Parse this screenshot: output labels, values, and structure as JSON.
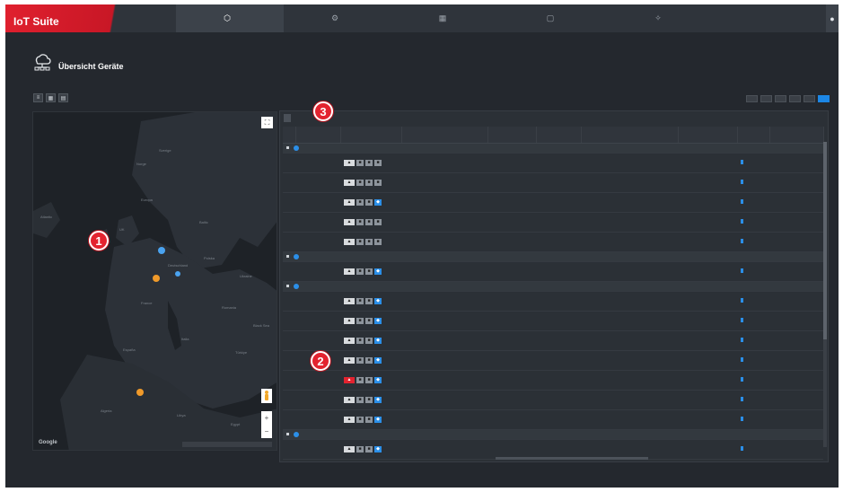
{
  "app": {
    "brand_small": "",
    "brand_name": "IoT Suite"
  },
  "nav": {
    "tabs": [
      {
        "label": "",
        "icon": "cube-icon"
      },
      {
        "label": "",
        "icon": "wrench-icon"
      },
      {
        "label": "",
        "icon": "grid-icon"
      },
      {
        "label": "",
        "icon": "box-icon"
      },
      {
        "label": "",
        "icon": "puzzle-icon"
      }
    ]
  },
  "page": {
    "breadcrumb": "",
    "title": "Übersicht Geräte"
  },
  "map": {
    "labels": [
      "Europa",
      "Atlantic",
      "Deutschland",
      "France",
      "España",
      "Italia",
      "Polska",
      "Sverige",
      "Norge",
      "UK",
      "Türkiye",
      "Ukraine",
      "Romania",
      "Algeria",
      "Libya",
      "Egypt",
      "Baltic",
      "Black Sea"
    ],
    "attribution": "Google"
  },
  "table": {
    "group_chip": "",
    "columns": [
      "",
      "",
      "",
      "",
      "",
      "",
      "",
      "",
      "",
      "",
      ""
    ],
    "groups": [
      {
        "label": "",
        "count_badge": "",
        "rows": [
          {
            "status": [
              "warn",
              "w",
              "w",
              "w"
            ],
            "name": "",
            "city": "",
            "country": "",
            "addr": "",
            "serial": "",
            "date": ""
          },
          {
            "status": [
              "warn",
              "w",
              "w",
              "w"
            ],
            "name": "",
            "city": "",
            "country": "",
            "addr": "",
            "serial": "",
            "date": ""
          },
          {
            "status": [
              "warn",
              "w",
              "w",
              "blue"
            ],
            "name": "",
            "city": "",
            "country": "",
            "addr": "",
            "serial": "",
            "date": ""
          },
          {
            "status": [
              "warn",
              "w",
              "w",
              "w"
            ],
            "name": "",
            "city": "",
            "country": "",
            "addr": "",
            "serial": "",
            "date": ""
          },
          {
            "status": [
              "warn",
              "w",
              "w",
              "w"
            ],
            "name": "",
            "city": "",
            "country": "",
            "addr": "",
            "serial": "",
            "date": ""
          }
        ]
      },
      {
        "label": "",
        "count_badge": "",
        "rows": [
          {
            "status": [
              "warn",
              "w",
              "w",
              "blue"
            ],
            "name": "",
            "city": "",
            "country": "",
            "addr": "",
            "serial": "",
            "date": ""
          }
        ]
      },
      {
        "label": "",
        "count_badge": "",
        "rows": [
          {
            "status": [
              "warn",
              "w",
              "w",
              "blue"
            ],
            "name": "",
            "city": "",
            "country": "",
            "addr": "",
            "serial": "",
            "date": ""
          },
          {
            "status": [
              "warn",
              "w",
              "w",
              "blue"
            ],
            "name": "",
            "city": "",
            "country": "",
            "addr": "",
            "serial": "",
            "date": ""
          },
          {
            "status": [
              "warn",
              "w",
              "w",
              "blue"
            ],
            "name": "",
            "city": "",
            "country": "",
            "addr": "",
            "serial": "",
            "date": ""
          },
          {
            "status": [
              "warn",
              "w",
              "w",
              "blue"
            ],
            "name": "",
            "city": "",
            "country": "",
            "addr": "",
            "serial": "",
            "date": ""
          },
          {
            "status": [
              "err",
              "w",
              "w",
              "blue"
            ],
            "name": "",
            "city": "",
            "country": "",
            "addr": "",
            "serial": "",
            "date": ""
          },
          {
            "status": [
              "warn",
              "w",
              "w",
              "blue"
            ],
            "name": "",
            "city": "",
            "country": "",
            "addr": "",
            "serial": "",
            "date": ""
          },
          {
            "status": [
              "warn",
              "w",
              "w",
              "blue"
            ],
            "name": "",
            "city": "",
            "country": "",
            "addr": "",
            "serial": "",
            "date": ""
          }
        ]
      },
      {
        "label": "",
        "count_badge": "",
        "rows": [
          {
            "status": [
              "warn",
              "w",
              "w",
              "blue"
            ],
            "name": "",
            "city": "",
            "country": "",
            "addr": "",
            "serial": "",
            "date": ""
          },
          {
            "status": [
              "err",
              "w",
              "w",
              "blue"
            ],
            "name": "",
            "city": "",
            "country": "",
            "addr": "",
            "serial": "",
            "date": ""
          }
        ]
      }
    ]
  },
  "callouts": [
    "1",
    "2",
    "3"
  ],
  "colors": {
    "brand_red": "#e0202e",
    "accent_blue": "#2b8fe8",
    "background": "#24282e"
  }
}
